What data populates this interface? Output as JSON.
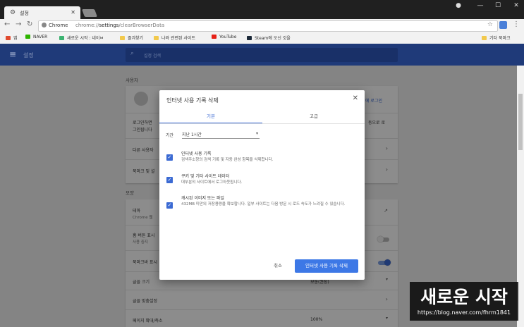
{
  "window": {
    "tab_title": "설정",
    "tab_close": "✕",
    "newtab": ""
  },
  "toolbar": {
    "chrome_label": "Chrome",
    "url_prefix": "chrome://",
    "url_bold": "settings",
    "url_suffix": "/clearBrowserData"
  },
  "bookmarks": {
    "items": [
      {
        "label": "앱",
        "color": "#e04a2f"
      },
      {
        "label": "NAVER",
        "color": "#2db400"
      },
      {
        "label": "새로운 시작 : 네이ㅂ",
        "color": "#3cb371"
      },
      {
        "label": "즐겨찾기",
        "color": "#f2c94c"
      },
      {
        "label": "나와 관련된 사이트",
        "color": "#f2c94c"
      },
      {
        "label": "YouTube",
        "color": "#e62117"
      },
      {
        "label": "Steam에 오신 것을",
        "color": "#1b2838"
      },
      {
        "label": "기타 북마크",
        "color": "#f2c94c"
      }
    ]
  },
  "settings": {
    "title": "설정",
    "search_placeholder": "설정 검색",
    "section_user": "사용자",
    "login_link": "에 로그인",
    "login_text1": "로그인하면",
    "login_text2": "그인됩니다",
    "login_right1": "동으로 로",
    "row_other_users": "다른 사용자",
    "row_bookmarks": "북마크 및 설",
    "section_appearance": "모양",
    "row_theme": "테마",
    "row_theme_sub": "Chrome 웹",
    "row_home": "홈 버튼 표시",
    "row_home_sub": "사용 중지",
    "row_bookmarkbar": "북마크바 표시",
    "row_fontsize": "글꼴 크기",
    "row_fontsize_val": "보통(권장)",
    "row_fontcustom": "글꼴 맞춤설정",
    "row_zoom": "페이지 확대/축소",
    "row_zoom_val": "100%"
  },
  "dialog": {
    "title": "인터넷 사용 기록 삭제",
    "close": "✕",
    "tab_basic": "기본",
    "tab_advanced": "고급",
    "period_label": "기간",
    "period_value": "지난 1시간",
    "options": [
      {
        "title": "인터넷 사용 기록",
        "desc": "검색주소창의 검색 기록 및 자동 완성 항목을 삭제합니다.",
        "checked": true
      },
      {
        "title": "쿠키 및 기타 사이트 데이터",
        "desc": "대부분의 사이트에서 로그아웃됩니다.",
        "checked": true
      },
      {
        "title": "캐시된 이미지 또는 파일",
        "desc": "432MB 미만의 저장용량을 확보합니다. 일부 사이트는 다음 방문 시 로드 속도가 느려질 수 있습니다.",
        "checked": true
      }
    ],
    "cancel": "취소",
    "confirm": "인터넷 사용 기록 삭제"
  },
  "watermark": {
    "title": "새로운 시작",
    "url": "https://blog.naver.com/fhrm1841"
  },
  "colors": {
    "accent": "#3b6ad3",
    "header": "#1f3a79",
    "button": "#3d78e6"
  }
}
